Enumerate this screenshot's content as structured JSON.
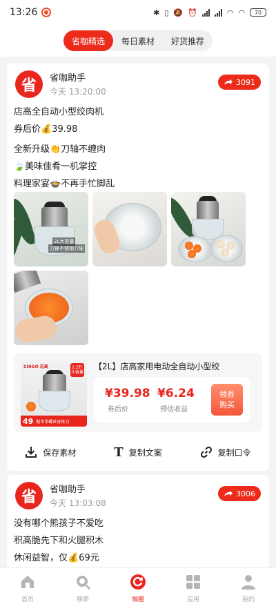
{
  "status": {
    "time": "13:26",
    "battery": "70"
  },
  "tabs": [
    {
      "label": "省咖精选",
      "active": true
    },
    {
      "label": "每日素材",
      "active": false
    },
    {
      "label": "好货推荐",
      "active": false
    }
  ],
  "posts": [
    {
      "avatar_char": "省",
      "author": "省咖助手",
      "time": "今天 13:20:00",
      "share_count": "3091",
      "lines": [
        "店高全自动小型绞肉机",
        "券后价💰39.98",
        "",
        "全新升级👏刀轴不缠肉",
        "🍃美味佳肴一机掌控",
        "料理家宴🍲不再手忙脚乱"
      ],
      "image_labels": [
        "2L大容量",
        "刀锋不锈钢刀轴"
      ],
      "product": {
        "title": "【2L】店高家用电动全自动小型绞",
        "brand": "CHIGO 志高",
        "capacity": "2.2升 大容量",
        "count": "49",
        "count_unit": "元",
        "tag": "配不带螺丝分体刀",
        "price": "¥39.98",
        "price_label": "券后价",
        "earn": "¥6.24",
        "earn_label": "预估收益",
        "coupon_line1": "领券",
        "coupon_line2": "购买"
      },
      "actions": [
        "保存素材",
        "复制文案",
        "复制口令"
      ]
    },
    {
      "avatar_char": "省",
      "author": "省咖助手",
      "time": "今天 13:03:08",
      "share_count": "3006",
      "lines": [
        "没有哪个熊孩子不爱吃",
        "积高脆先下和火腿积木",
        "休闲益智，仅💰69元"
      ]
    }
  ],
  "nav": [
    {
      "label": "首页",
      "active": false
    },
    {
      "label": "搜索",
      "active": false
    },
    {
      "label": "咖圈",
      "active": true
    },
    {
      "label": "应用",
      "active": false
    },
    {
      "label": "我的",
      "active": false
    }
  ],
  "colors": {
    "accent": "#ec2b1b"
  }
}
